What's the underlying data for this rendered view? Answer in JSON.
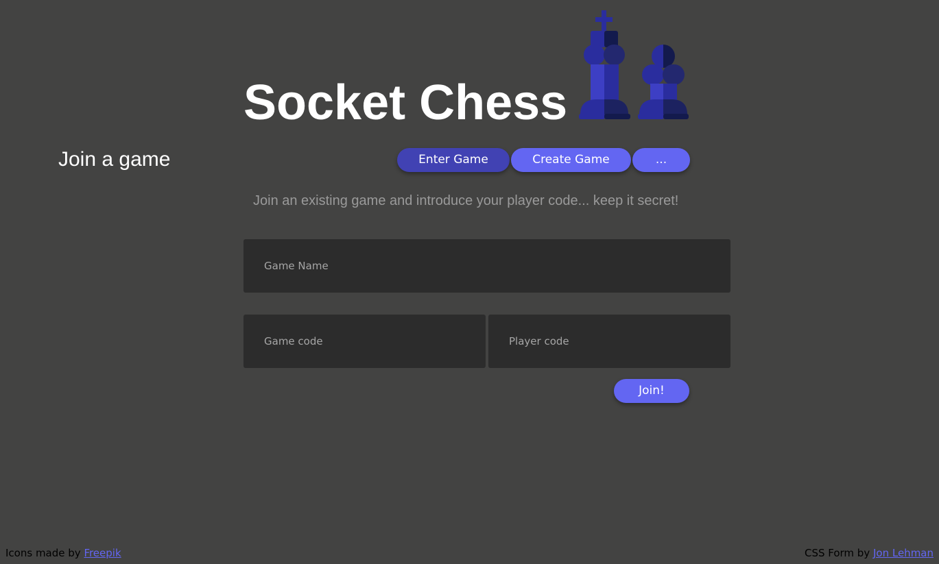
{
  "header": {
    "title": "Socket Chess",
    "icons": [
      "chess-king-icon",
      "chess-pawn-icon"
    ]
  },
  "section": {
    "heading": "Join a game",
    "description": "Join an existing game and introduce your player code... keep it secret!"
  },
  "tabs": [
    {
      "label": "Enter Game",
      "active": true
    },
    {
      "label": "Create Game",
      "active": false
    },
    {
      "label": "...",
      "active": false
    }
  ],
  "form": {
    "game_name": {
      "placeholder": "Game Name",
      "value": ""
    },
    "game_code": {
      "placeholder": "Game code",
      "value": ""
    },
    "player_code": {
      "placeholder": "Player code",
      "value": ""
    },
    "submit_label": "Join!"
  },
  "footer": {
    "left_prefix": "Icons made by ",
    "left_link": "Freepik",
    "right_prefix": "CSS Form by ",
    "right_link": "Jon Lehman"
  },
  "colors": {
    "background": "#434342",
    "accent": "#6366f2",
    "accent_active": "#4142b3",
    "input_background": "#2c2c2c",
    "piece_light": "#3d3fc4",
    "piece_mid": "#2a2d9e",
    "piece_dark": "#131a4d"
  }
}
